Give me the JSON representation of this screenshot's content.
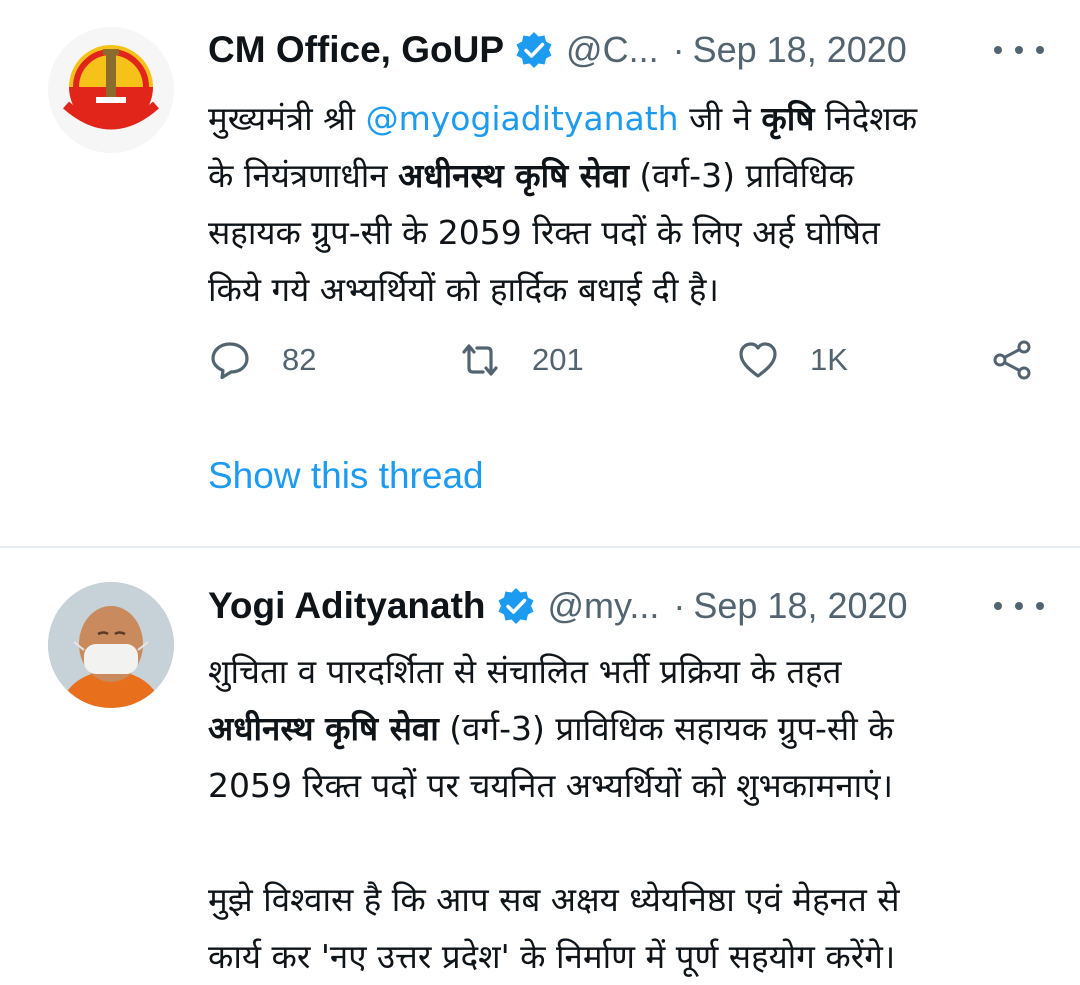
{
  "tweets": [
    {
      "author_name": "CM Office, GoUP",
      "handle": "@C...",
      "separator": "·",
      "date": "Sep 18, 2020",
      "text_lines": [
        [
          {
            "t": "मुख्यमंत्री श्री "
          },
          {
            "t": "@myogiadityanath",
            "mention": true
          },
          {
            "t": " जी ने "
          },
          {
            "t": "कृषि",
            "bold": true
          },
          {
            "t": " निदेशक"
          }
        ],
        [
          {
            "t": "के नियंत्रणाधीन "
          },
          {
            "t": "अधीनस्थ कृषि सेवा",
            "bold": true
          },
          {
            "t": " (वर्ग-3) प्राविधिक"
          }
        ],
        [
          {
            "t": "सहायक ग्रुप-सी के 2059 रिक्त पदों के लिए अर्ह घोषित"
          }
        ],
        [
          {
            "t": "किये गये अभ्यर्थियों को हार्दिक बधाई दी है।"
          }
        ]
      ],
      "actions": {
        "reply_count": "82",
        "retweet_count": "201",
        "like_count": "1K"
      },
      "show_thread_label": "Show this thread"
    },
    {
      "author_name": "Yogi Adityanath",
      "handle": "@my...",
      "separator": "·",
      "date": "Sep 18, 2020",
      "text_lines": [
        [
          {
            "t": "शुचिता व पारदर्शिता से संचालित भर्ती प्रक्रिया के तहत"
          }
        ],
        [
          {
            "t": "अधीनस्थ कृषि सेवा",
            "bold": true
          },
          {
            "t": " (वर्ग-3) प्राविधिक सहायक ग्रुप-सी के"
          }
        ],
        [
          {
            "t": "2059 रिक्त पदों पर चयनित अभ्यर्थियों को शुभकामनाएं।"
          }
        ],
        [],
        [
          {
            "t": "मुझे विश्वास है कि आप सब अक्षय ध्येयनिष्ठा एवं मेहनत से"
          }
        ],
        [
          {
            "t": "कार्य कर 'नए उत्तर प्रदेश' के निर्माण में पूर्ण सहयोग करेंगे।"
          }
        ]
      ]
    }
  ],
  "icons": {
    "verified": "verified-badge-icon",
    "more": "more-options-icon",
    "reply": "reply-icon",
    "retweet": "retweet-icon",
    "like": "like-icon",
    "share": "share-icon"
  },
  "colors": {
    "accent": "#1d9bf0",
    "secondary_text": "#536471",
    "primary_text": "#0f1419",
    "divider": "#e6ecf0"
  }
}
